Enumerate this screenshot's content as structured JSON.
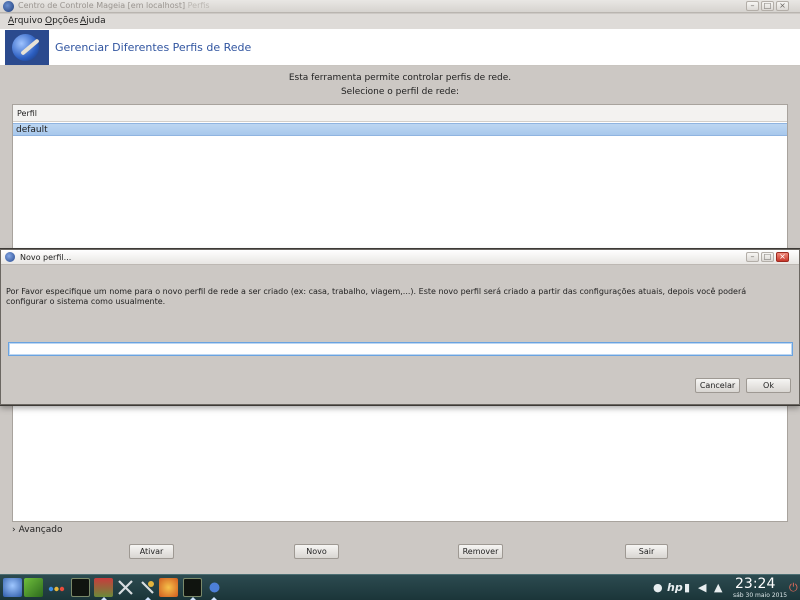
{
  "window": {
    "title": "Centro de Controle Mageia  [em localhost]",
    "title_faded": "Perfis"
  },
  "menu": {
    "items": [
      {
        "label": "Arquivo"
      },
      {
        "label": "Opções"
      },
      {
        "label": "Ajuda"
      }
    ]
  },
  "banner": {
    "title": "Gerenciar Diferentes Perfis de Rede"
  },
  "main": {
    "intro_line1": "Esta ferramenta permite controlar perfis de rede.",
    "intro_line2": "Selecione o perfil de rede:",
    "list_header": "Perfil",
    "profiles": [
      {
        "name": "default",
        "selected": true
      }
    ],
    "advanced_label": "Avançado",
    "buttons": {
      "activate": "Ativar",
      "new": "Novo",
      "remove": "Remover",
      "quit": "Sair"
    }
  },
  "dialog": {
    "title": "Novo perfil...",
    "message": "Por Favor especifique um nome para o novo perfil de rede a ser criado (ex: casa, trabalho, viagem,...). Este novo perfil será criado a partir das configurações atuais, depois você poderá configurar o sistema como usualmente.",
    "input_value": "",
    "cancel_label": "Cancelar",
    "ok_label": "Ok"
  },
  "taskbar": {
    "clock": "23:24",
    "date": "sáb 30 maio 2015"
  },
  "colors": {
    "accent": "#3155a0",
    "selection": "#bcd6f2",
    "window_bg": "#ccc8c4",
    "taskbar": "#1f3b3f"
  }
}
